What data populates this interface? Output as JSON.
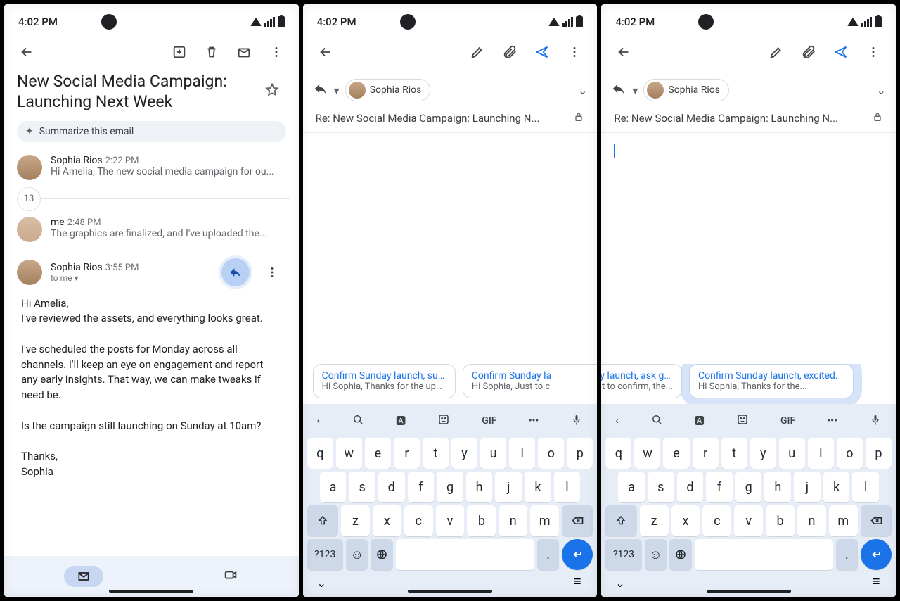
{
  "status": {
    "time": "4:02 PM"
  },
  "screen1": {
    "subject": "New Social Media Campaign: Launching Next Week",
    "summarize_label": "Summarize this email",
    "thread_count": "13",
    "msg1": {
      "sender": "Sophia Rios",
      "time": "2:22 PM",
      "preview": "Hi Amelia, The new social media campaign for ou..."
    },
    "msg2": {
      "sender": "me",
      "time": "2:48 PM",
      "preview": "The graphics are finalized, and I've uploaded the..."
    },
    "msg3": {
      "sender": "Sophia Rios",
      "time": "3:55 PM",
      "to": "to me"
    },
    "body": "Hi Amelia,\nI've reviewed the assets, and everything looks great.\n\nI've scheduled the posts for Monday across all channels. I'll keep an eye on engagement and report any early insights. That way, we can make tweaks if need be.\n\nIs the campaign still launching on Sunday at 10am?\n\nThanks,\nSophia"
  },
  "compose": {
    "recipient": "Sophia Rios",
    "subject": "Re: New Social Media Campaign: Launching N..."
  },
  "suggestions2": [
    {
      "title": "Confirm Sunday launch, sugge...",
      "preview": "Hi Sophia, Thanks for the updat..."
    },
    {
      "title": "Confirm Sunday la",
      "preview": "Hi Sophia, Just to c"
    }
  ],
  "suggestions3": [
    {
      "title": "lay launch, ask goals",
      "preview": "t to confirm, the..."
    },
    {
      "title": "Confirm Sunday launch, excited.",
      "preview": "Hi Sophia, Thanks for the..."
    }
  ],
  "kbd": {
    "strip_gif": "GIF",
    "rows": [
      [
        "q",
        "w",
        "e",
        "r",
        "t",
        "y",
        "u",
        "i",
        "o",
        "p"
      ],
      [
        "a",
        "s",
        "d",
        "f",
        "g",
        "h",
        "j",
        "k",
        "l"
      ],
      [
        "z",
        "x",
        "c",
        "v",
        "b",
        "n",
        "m"
      ]
    ],
    "num_key": "?123",
    "period": "."
  }
}
